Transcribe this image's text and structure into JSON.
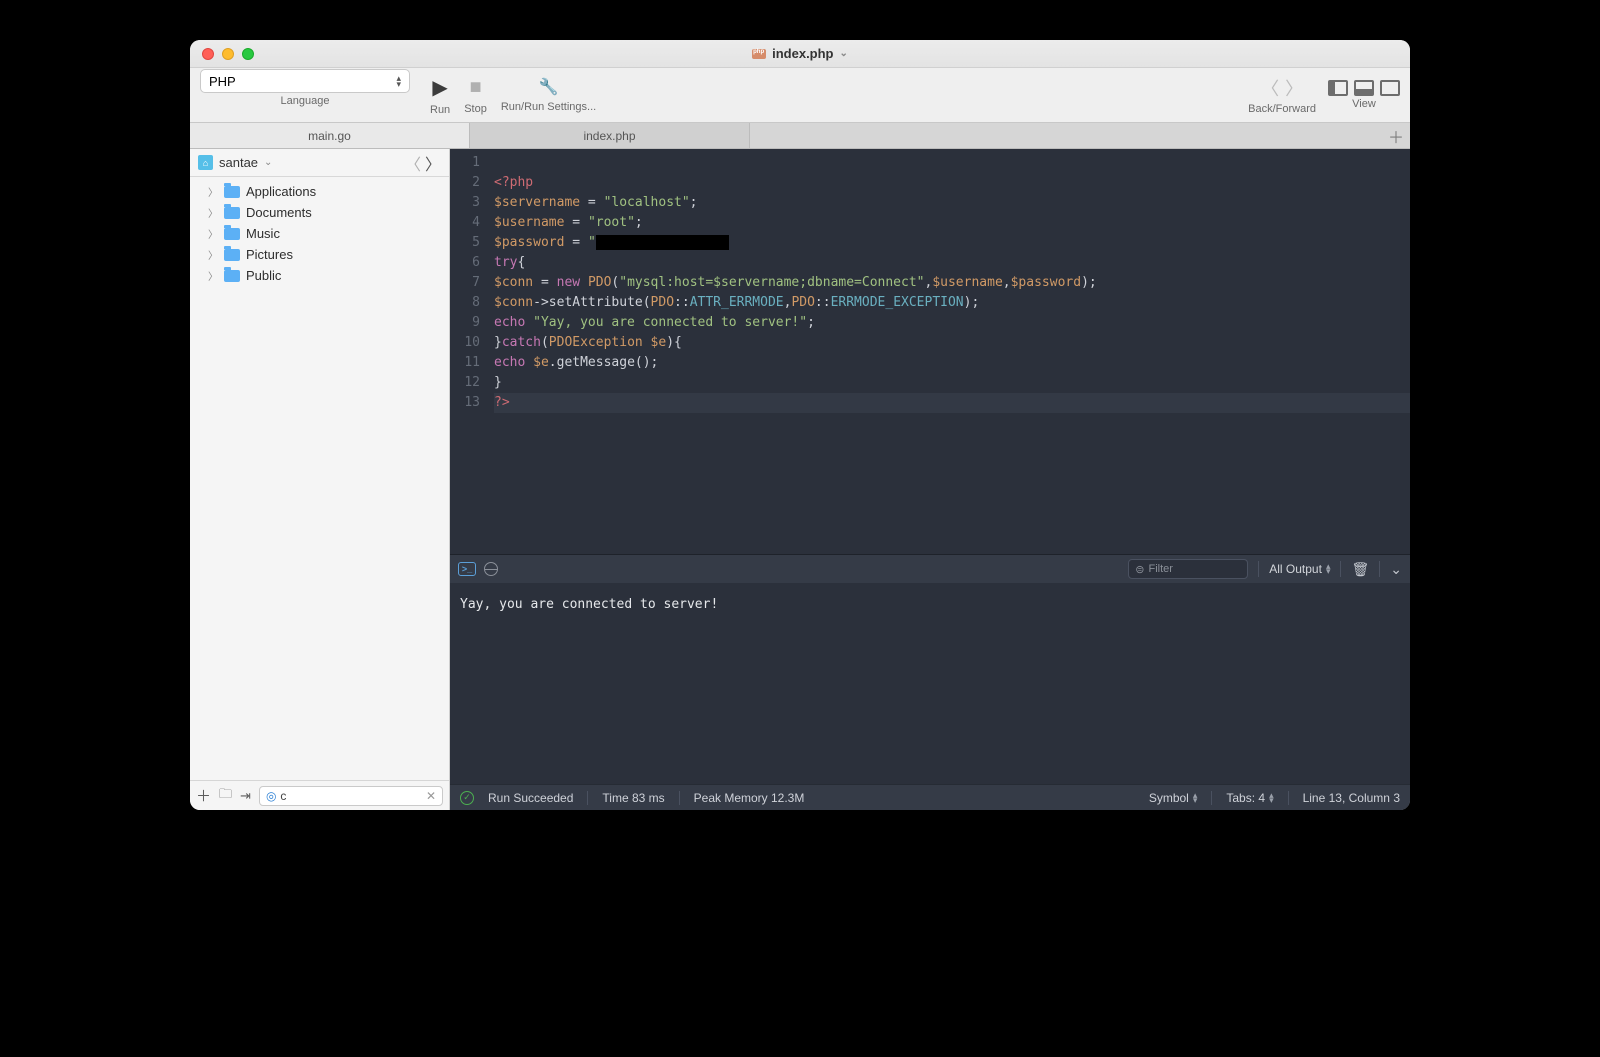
{
  "title": "index.php",
  "toolbar": {
    "lang_label": "Language",
    "lang_value": "PHP",
    "run": "Run",
    "stop": "Stop",
    "runsettings": "Run/Run Settings...",
    "backfwd": "Back/Forward",
    "view": "View"
  },
  "tabs": {
    "t1": "main.go",
    "t2": "index.php"
  },
  "sidebar": {
    "root": "santae",
    "items": [
      "Applications",
      "Documents",
      "Music",
      "Pictures",
      "Public"
    ],
    "search_value": "c"
  },
  "code": {
    "lines": [
      {
        "n": "1",
        "html": ""
      },
      {
        "n": "2",
        "html": "<span class='tag'>&lt;?php</span>"
      },
      {
        "n": "3",
        "html": "<span class='var'>$servername</span> <span class='op'>=</span> <span class='str'>\"localhost\"</span><span class='op'>;</span>"
      },
      {
        "n": "4",
        "html": "<span class='var'>$username</span> <span class='op'>=</span> <span class='str'>\"root\"</span><span class='op'>;</span>"
      },
      {
        "n": "5",
        "html": "<span class='var'>$password</span> <span class='op'>=</span> <span class='str'>\"</span><span class='redacted'>                 </span>"
      },
      {
        "n": "6",
        "html": "<span class='kw'>try</span><span class='op'>{</span>"
      },
      {
        "n": "7",
        "html": "<span class='var'>$conn</span> <span class='op'>=</span> <span class='kw'>new</span> <span class='cls'>PDO</span><span class='op'>(</span><span class='str'>\"mysql:host=$servername;dbname=Connect\"</span><span class='op'>,</span><span class='var'>$username</span><span class='op'>,</span><span class='var'>$password</span><span class='op'>);</span>"
      },
      {
        "n": "8",
        "html": "<span class='var'>$conn</span><span class='op'>-></span><span class='fn'>setAttribute</span><span class='op'>(</span><span class='cls'>PDO</span><span class='op'>::</span><span class='const'>ATTR_ERRMODE</span><span class='op'>,</span><span class='cls'>PDO</span><span class='op'>::</span><span class='const'>ERRMODE_EXCEPTION</span><span class='op'>);</span>"
      },
      {
        "n": "9",
        "html": "<span class='kw'>echo</span> <span class='str'>\"Yay, you are connected to server!\"</span><span class='op'>;</span>"
      },
      {
        "n": "10",
        "html": "<span class='op'>}</span><span class='kw'>catch</span><span class='op'>(</span><span class='cls'>PDOException</span> <span class='var'>$e</span><span class='op'>){</span>"
      },
      {
        "n": "11",
        "html": "<span class='kw'>echo</span> <span class='var'>$e</span><span class='op'>.</span><span class='fn'>getMessage</span><span class='op'>();</span>"
      },
      {
        "n": "12",
        "html": "<span class='op'>}</span>"
      },
      {
        "n": "13",
        "html": "<span class='tag'>?&gt;</span>",
        "current": true
      }
    ]
  },
  "console": {
    "filter_ph": "Filter",
    "dd": "All Output",
    "output": "Yay, you are connected to server!"
  },
  "status": {
    "run": "Run Succeeded",
    "time": "Time 83 ms",
    "mem": "Peak Memory 12.3M",
    "symbol": "Symbol",
    "tabs": "Tabs: 4",
    "cursor": "Line 13, Column 3"
  }
}
